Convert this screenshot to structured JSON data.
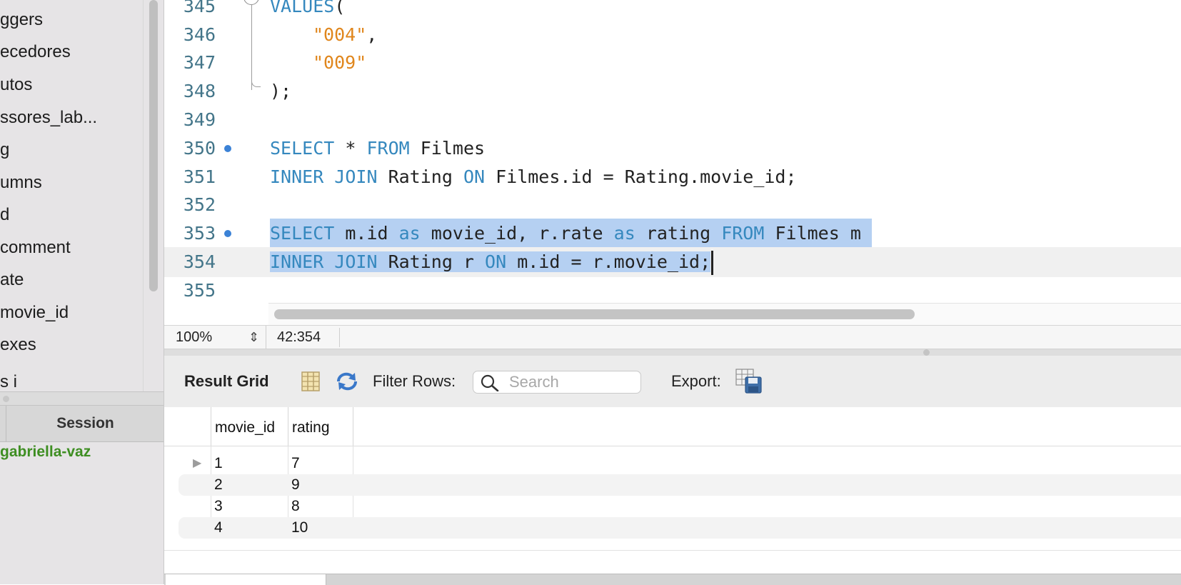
{
  "sidebar": {
    "tree_items": [
      "ggers",
      "ecedores",
      "utos",
      "ssores_lab...",
      "g",
      "umns",
      "d",
      "comment",
      "ate",
      "movie_id",
      "exes",
      "s  i  "
    ],
    "session_header": "Session",
    "session_user": "gabriella-vaz",
    "session_user_color": "#3e8e22"
  },
  "editor": {
    "lines": {
      "l345": {
        "no": "345",
        "kw": "VALUES",
        "paren": "("
      },
      "l346": {
        "no": "346",
        "str": "\"004\"",
        "punct": ","
      },
      "l347": {
        "no": "347",
        "str": "\"009\""
      },
      "l348": {
        "no": "348",
        "punct": ");"
      },
      "l349": {
        "no": "349"
      },
      "l350": {
        "no": "350",
        "kw1": "SELECT",
        "star": " * ",
        "kw2": "FROM",
        "t1": " Filmes"
      },
      "l351": {
        "no": "351",
        "kw1": "INNER JOIN",
        "t1": " Rating ",
        "kw2": "ON",
        "t2": " Filmes.id = Rating.movie_id;"
      },
      "l352": {
        "no": "352"
      },
      "l353": {
        "no": "353",
        "kw1": "SELECT",
        "t1": " m.id ",
        "kw2": "as",
        "t2": " movie_id, r.rate ",
        "kw3": "as",
        "t3": " rating ",
        "kw4": "FROM",
        "t4": " Filmes m "
      },
      "l354": {
        "no": "354",
        "kw1": "INNER JOIN",
        "t1": " Rating r ",
        "kw2": "ON",
        "t2": " m.id = r.movie_id;"
      },
      "l355": {
        "no": "355"
      }
    },
    "keyword_color": "#3588be",
    "string_color": "#e0861c",
    "selection_color": "#b5d0f2"
  },
  "status": {
    "zoom": "100%",
    "cursor_position": "42:354"
  },
  "results": {
    "title": "Result Grid",
    "filter_label": "Filter Rows:",
    "search_placeholder": "Search",
    "export_label": "Export:",
    "columns": [
      "movie_id",
      "rating"
    ],
    "rows": [
      [
        "1",
        "7"
      ],
      [
        "2",
        "9"
      ],
      [
        "3",
        "8"
      ],
      [
        "4",
        "10"
      ]
    ],
    "row_indicator": "▶"
  }
}
